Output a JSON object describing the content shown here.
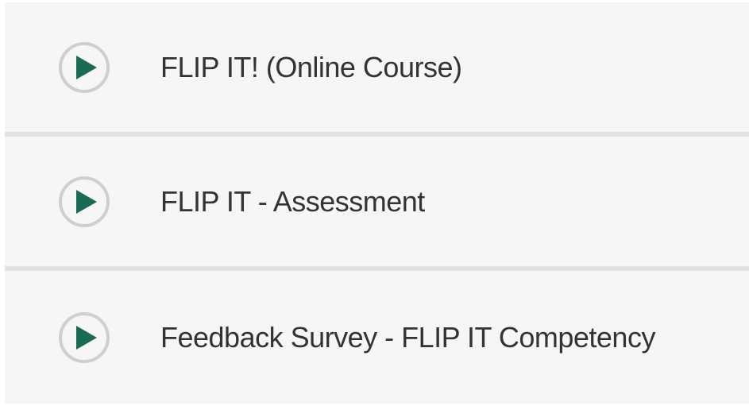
{
  "items": [
    {
      "label": "FLIP IT! (Online Course)",
      "icon": "play-icon"
    },
    {
      "label": "FLIP IT - Assessment",
      "icon": "play-icon"
    },
    {
      "label": "Feedback Survey - FLIP IT Competency",
      "icon": "play-icon"
    }
  ],
  "colors": {
    "play_triangle": "#1a6b55",
    "play_ring": "#cfcfcf",
    "row_background": "#f6f6f6",
    "divider": "#e2e2e2",
    "text": "#333333"
  }
}
